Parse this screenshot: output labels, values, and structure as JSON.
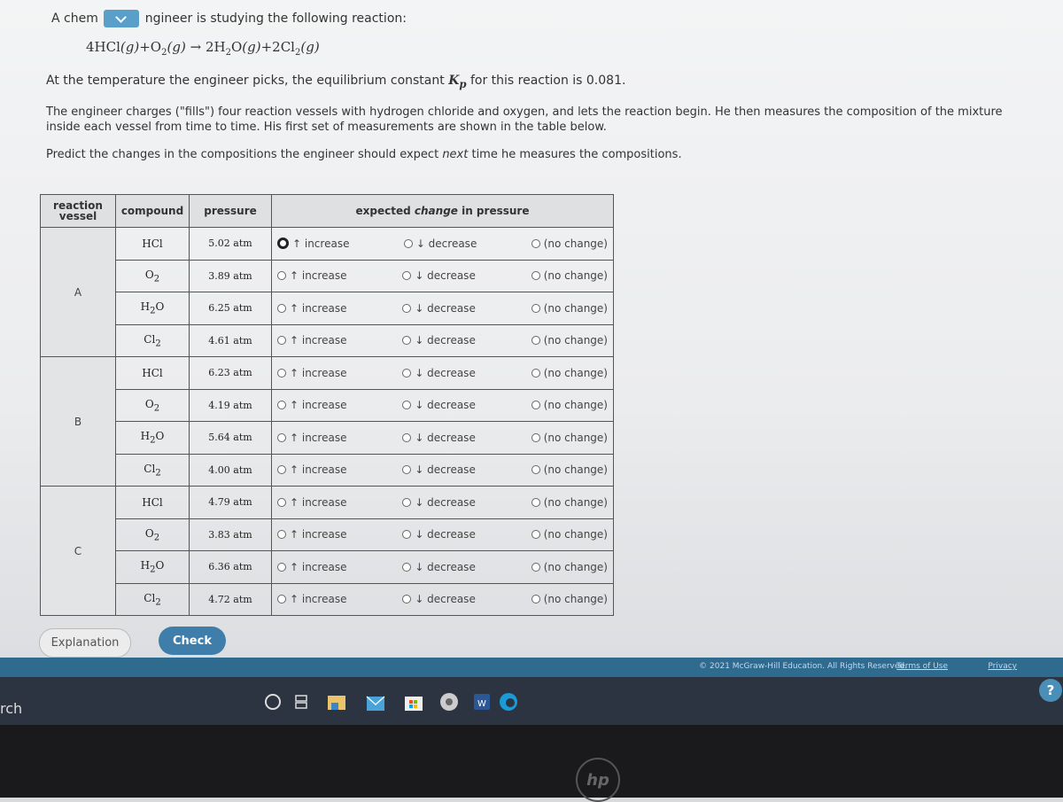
{
  "question": {
    "intro_before": "A chem",
    "intro_after": "ngineer is studying the following reaction:",
    "equation": {
      "r1_coef": "4",
      "r1": "HCl",
      "r1_state": "(g)",
      "plus1": "+",
      "r2": "O",
      "r2_sub": "2",
      "r2_state": "(g)",
      "arrow": "→",
      "p1_coef": "2",
      "p1a": "H",
      "p1_sub": "2",
      "p1b": "O",
      "p1_state": "(g)",
      "plus2": "+",
      "p2_coef": "2",
      "p2": "Cl",
      "p2_sub": "2",
      "p2_state": "(g)"
    },
    "kp_before": "At the temperature the engineer picks, the equilibrium constant ",
    "kp_symbol": "K",
    "kp_sub": "p",
    "kp_after": " for this reaction is 0.081.",
    "paragraph": "The engineer charges (\"fills\") four reaction vessels with hydrogen chloride and oxygen, and lets the reaction begin. He then measures the composition of the mixture inside each vessel from time to time. His first set of measurements are shown in the table below.",
    "predict_before": "Predict the changes in the compositions the engineer should expect ",
    "predict_em": "next",
    "predict_after": " time he measures the compositions."
  },
  "table": {
    "headers": {
      "vessel_1": "reaction",
      "vessel_2": "vessel",
      "compound": "compound",
      "pressure": "pressure",
      "change_before": "expected ",
      "change_em": "change",
      "change_after": " in pressure"
    },
    "option_labels": {
      "increase": "↑ increase",
      "decrease": "↓ decrease",
      "none": "(no change)"
    },
    "vessels": [
      {
        "name": "A",
        "rows": [
          {
            "compound": "HCl",
            "sub": "",
            "pressure": "5.02 atm",
            "selected": "increase"
          },
          {
            "compound": "O",
            "sub": "2",
            "pressure": "3.89 atm",
            "selected": ""
          },
          {
            "compound": "H",
            "sub": "2",
            "tail": "O",
            "pressure": "6.25 atm",
            "selected": ""
          },
          {
            "compound": "Cl",
            "sub": "2",
            "pressure": "4.61 atm",
            "selected": ""
          }
        ]
      },
      {
        "name": "B",
        "rows": [
          {
            "compound": "HCl",
            "sub": "",
            "pressure": "6.23 atm",
            "selected": ""
          },
          {
            "compound": "O",
            "sub": "2",
            "pressure": "4.19 atm",
            "selected": ""
          },
          {
            "compound": "H",
            "sub": "2",
            "tail": "O",
            "pressure": "5.64 atm",
            "selected": ""
          },
          {
            "compound": "Cl",
            "sub": "2",
            "pressure": "4.00 atm",
            "selected": ""
          }
        ]
      },
      {
        "name": "C",
        "rows": [
          {
            "compound": "HCl",
            "sub": "",
            "pressure": "4.79 atm",
            "selected": ""
          },
          {
            "compound": "O",
            "sub": "2",
            "pressure": "3.83 atm",
            "selected": ""
          },
          {
            "compound": "H",
            "sub": "2",
            "tail": "O",
            "pressure": "6.36 atm",
            "selected": ""
          },
          {
            "compound": "Cl",
            "sub": "2",
            "pressure": "4.72 atm",
            "selected": ""
          }
        ]
      }
    ]
  },
  "buttons": {
    "explanation": "Explanation",
    "check": "Check"
  },
  "footer": {
    "copyright": "© 2021 McGraw-Hill Education. All Rights Reserved.",
    "terms": "Terms of Use",
    "privacy": "Privacy"
  },
  "taskbar": {
    "search_partial": "rch",
    "help": "?",
    "brand": "hp",
    "icons": [
      "cortana-icon",
      "task-view-icon",
      "file-explorer-icon",
      "mail-icon",
      "store-icon",
      "chrome-icon",
      "word-icon",
      "edge-icon"
    ]
  }
}
